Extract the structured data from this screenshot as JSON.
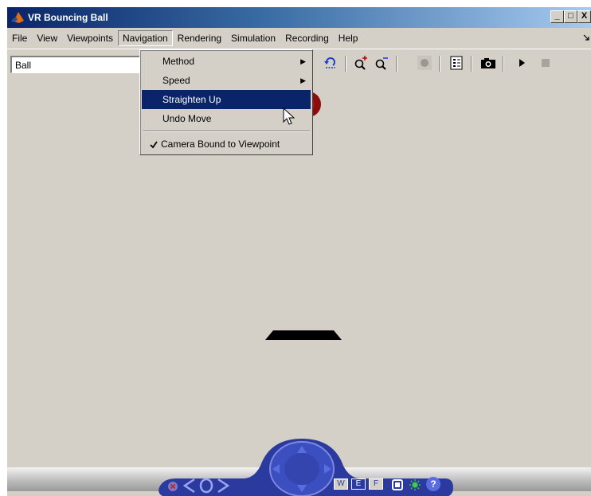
{
  "window": {
    "title": "VR Bouncing Ball",
    "minimize_label": "_",
    "maximize_label": "□",
    "close_label": "X"
  },
  "menubar": {
    "items": [
      "File",
      "View",
      "Viewpoints",
      "Navigation",
      "Rendering",
      "Simulation",
      "Recording",
      "Help"
    ],
    "open_item": "Navigation"
  },
  "toolbar": {
    "viewpoint_combo_value": "Ball",
    "tools": [
      "undo-viewpoint-icon",
      "zoom-in-icon",
      "zoom-out-icon",
      "record-icon",
      "properties-icon",
      "capture-icon",
      "play-icon",
      "stop-icon"
    ]
  },
  "navigation_menu": {
    "items": [
      {
        "label": "Method",
        "submenu": true
      },
      {
        "label": "Speed",
        "submenu": true
      },
      {
        "label": "Straighten Up",
        "highlighted": true
      },
      {
        "label": "Undo Move"
      },
      {
        "label": "Camera Bound to Viewpoint",
        "checked": true
      }
    ]
  },
  "navpanel": {
    "walk_label": "W",
    "examine_label": "E",
    "fly_label": "F",
    "help_label": "?"
  },
  "colors": {
    "title_start": "#0a246a",
    "title_end": "#a6caf0",
    "menu_highlight": "#0a246a",
    "canvas": "#d4d0c8",
    "navpanel": "#2b3a9e"
  }
}
